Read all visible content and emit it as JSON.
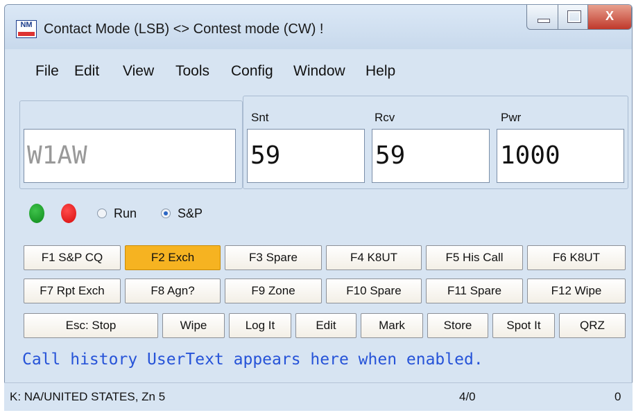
{
  "window": {
    "title": "Contact Mode (LSB) <> Contest mode (CW) !",
    "icon_text": "NM",
    "close_glyph": "X"
  },
  "menu": [
    "File",
    "Edit",
    "View",
    "Tools",
    "Config",
    "Window",
    "Help"
  ],
  "entry": {
    "call_value": "W1AW",
    "snt_label": "Snt",
    "snt_value": "59",
    "rcv_label": "Rcv",
    "rcv_value": "59",
    "pwr_label": "Pwr",
    "pwr_value": "1000"
  },
  "indicators": {
    "green_color": "#0e8a1c",
    "red_color": "#d60d0d"
  },
  "mode": {
    "run_label": "Run",
    "sp_label": "S&P",
    "selected": "S&P"
  },
  "fkeys_row1": [
    "F1 S&P CQ",
    "F2 Exch",
    "F3 Spare",
    "F4 K8UT",
    "F5 His Call",
    "F6 K8UT"
  ],
  "fkeys_row2": [
    "F7 Rpt Exch",
    "F8 Agn?",
    "F9 Zone",
    "F10 Spare",
    "F11 Spare",
    "F12 Wipe"
  ],
  "action_row": [
    "Esc: Stop",
    "Wipe",
    "Log It",
    "Edit",
    "Mark",
    "Store",
    "Spot It",
    "QRZ"
  ],
  "active_key": "F2 Exch",
  "usertext": "Call history UserText appears here when enabled.",
  "status": {
    "left": "K: NA/UNITED STATES, Zn 5",
    "middle": "4/0",
    "right": "0"
  }
}
